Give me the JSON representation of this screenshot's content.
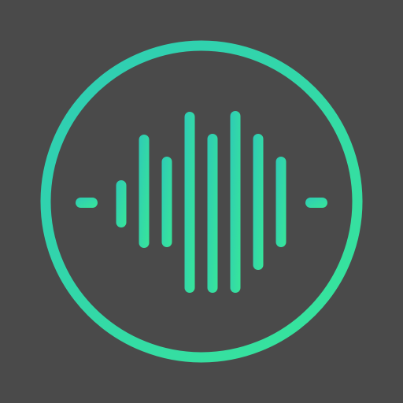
{
  "app_icon": {
    "icon_name": "sound-wave-icon",
    "colors": {
      "background": "#4a4a4a",
      "accent_start": "#2ecbb5",
      "accent_end": "#38e69a"
    }
  }
}
